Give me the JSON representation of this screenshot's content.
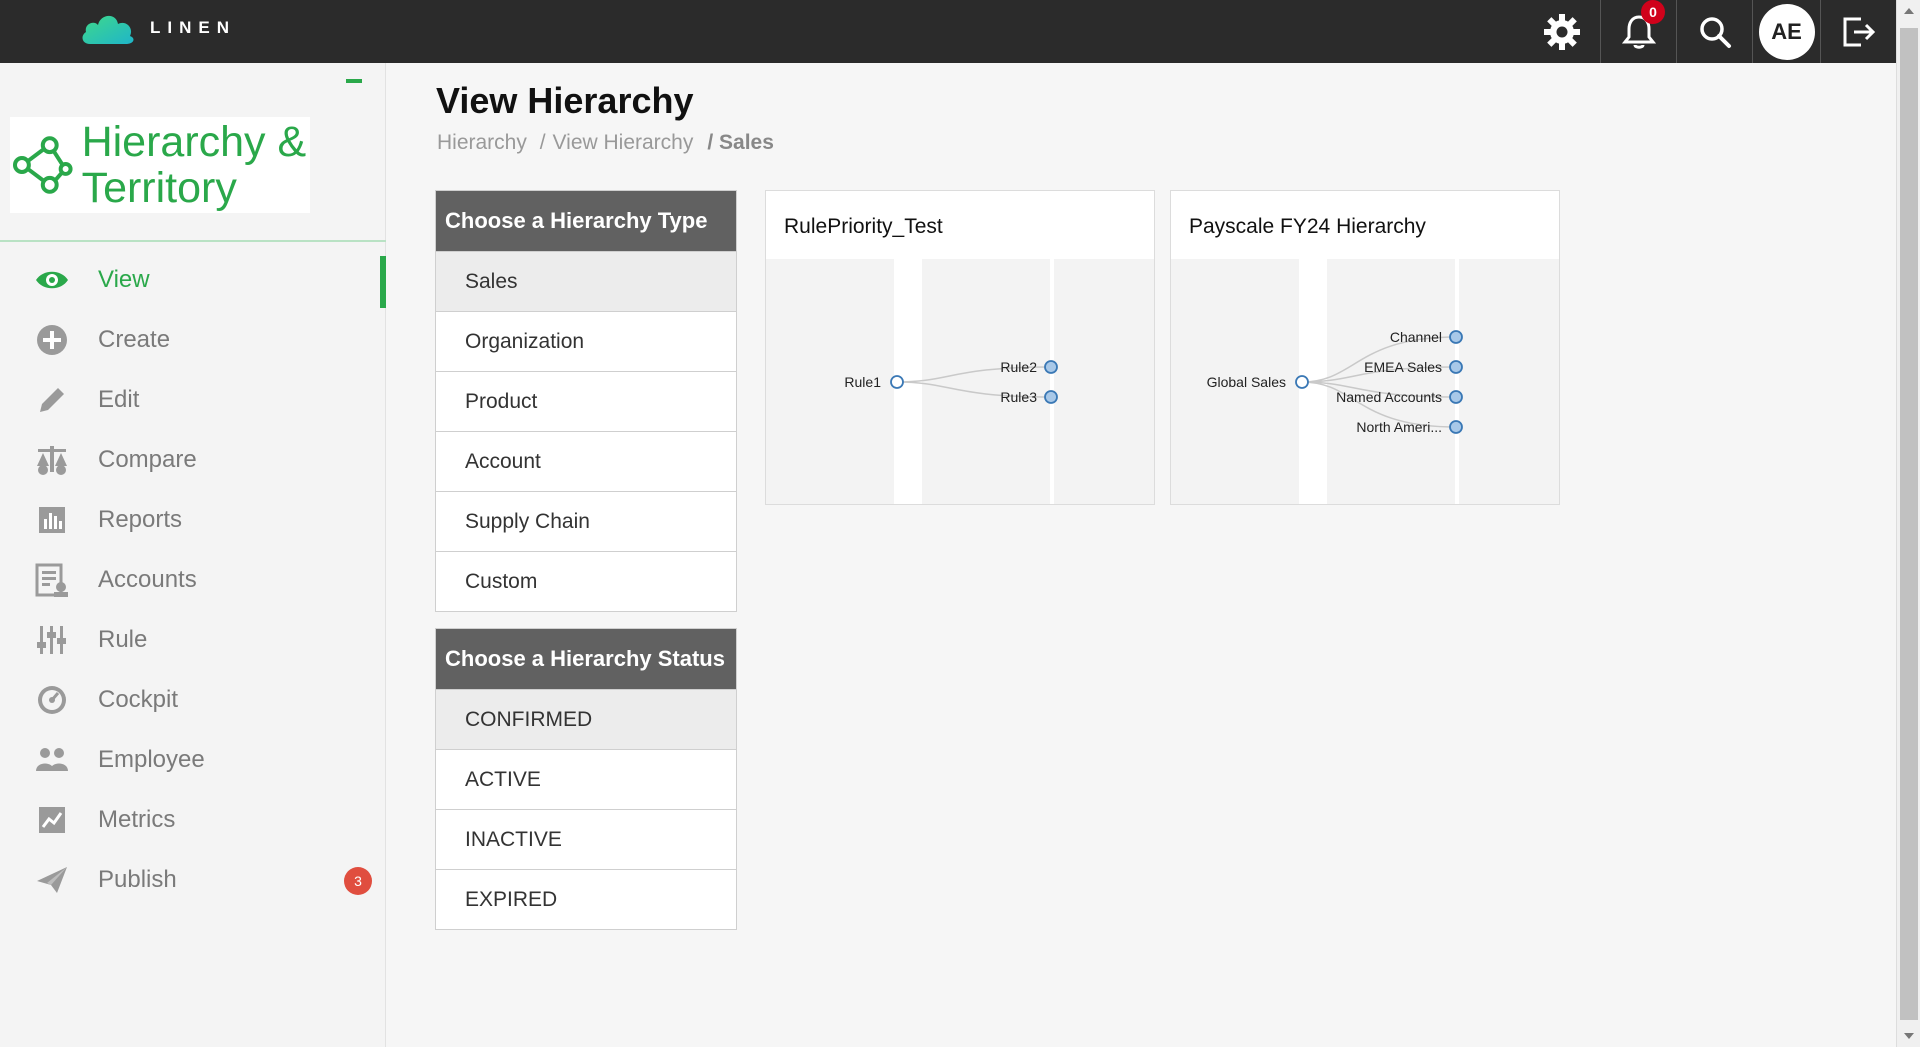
{
  "app": {
    "logo_text": "LINEN"
  },
  "topbar": {
    "notification_count": "0",
    "avatar_initials": "AE"
  },
  "sidebar": {
    "module_title": "Hierarchy & Territory",
    "items": [
      {
        "label": "View",
        "icon": "eye-icon",
        "active": true
      },
      {
        "label": "Create",
        "icon": "plus-circle-icon"
      },
      {
        "label": "Edit",
        "icon": "pencil-icon"
      },
      {
        "label": "Compare",
        "icon": "scales-icon"
      },
      {
        "label": "Reports",
        "icon": "bar-chart-icon"
      },
      {
        "label": "Accounts",
        "icon": "accounts-list-icon"
      },
      {
        "label": "Rule",
        "icon": "sliders-icon"
      },
      {
        "label": "Cockpit",
        "icon": "gauge-icon"
      },
      {
        "label": "Employee",
        "icon": "people-icon"
      },
      {
        "label": "Metrics",
        "icon": "line-chart-icon"
      },
      {
        "label": "Publish",
        "icon": "paper-plane-icon",
        "badge": "3"
      }
    ]
  },
  "main": {
    "page_title": "View Hierarchy",
    "breadcrumb": [
      "Hierarchy",
      "View Hierarchy",
      "Sales"
    ],
    "type_filter": {
      "header": "Choose a Hierarchy Type",
      "options": [
        "Sales",
        "Organization",
        "Product",
        "Account",
        "Supply Chain",
        "Custom"
      ],
      "selected": "Sales"
    },
    "status_filter": {
      "header": "Choose a Hierarchy Status",
      "options": [
        "CONFIRMED",
        "ACTIVE",
        "INACTIVE",
        "EXPIRED"
      ],
      "selected": "CONFIRMED"
    },
    "cards": [
      {
        "title": "RulePriority_Test",
        "root": "Rule1",
        "children": [
          "Rule2",
          "Rule3"
        ]
      },
      {
        "title": "Payscale FY24 Hierarchy",
        "root": "Global Sales",
        "children": [
          "Channel",
          "EMEA Sales",
          "Named Accounts",
          "North Ameri..."
        ]
      }
    ]
  },
  "colors": {
    "brand_green": "#2aa84a",
    "topbar_bg": "#2b2b2b",
    "panel_header": "#616161",
    "badge_red": "#d0021b",
    "node_fill": "#a8c8e8",
    "node_stroke": "#3a78b5"
  }
}
